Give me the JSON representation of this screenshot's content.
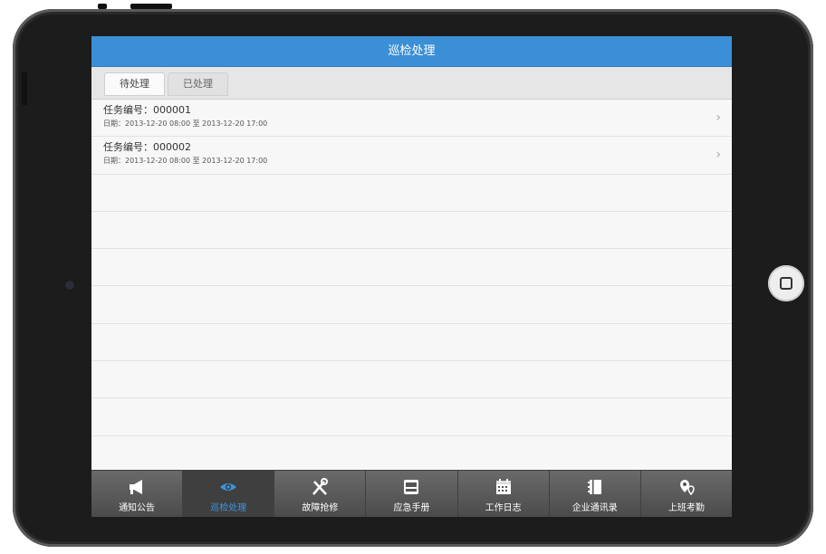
{
  "navbar": {
    "title": "巡检处理"
  },
  "segments": [
    {
      "label": "待处理",
      "active": true
    },
    {
      "label": "已处理",
      "active": false
    }
  ],
  "tasks": [
    {
      "title": "任务编号：000001",
      "date": "日期：2013-12-20 08:00 至 2013-12-20 17:00"
    },
    {
      "title": "任务编号：000002",
      "date": "日期：2013-12-20 08:00 至 2013-12-20 17:00"
    }
  ],
  "tabbar": {
    "items": [
      {
        "label": "通知公告",
        "icon": "megaphone-icon"
      },
      {
        "label": "巡检处理",
        "icon": "eye-icon",
        "active": true
      },
      {
        "label": "故障抢修",
        "icon": "tools-icon"
      },
      {
        "label": "应急手册",
        "icon": "manual-icon"
      },
      {
        "label": "工作日志",
        "icon": "calendar-icon"
      },
      {
        "label": "企业通讯录",
        "icon": "contacts-icon"
      },
      {
        "label": "上班考勤",
        "icon": "location-pin-icon"
      }
    ]
  },
  "colors": {
    "accent": "#3b8fd6",
    "tab_active_text": "#3b95e0",
    "tabbar_bg": "#555555"
  }
}
